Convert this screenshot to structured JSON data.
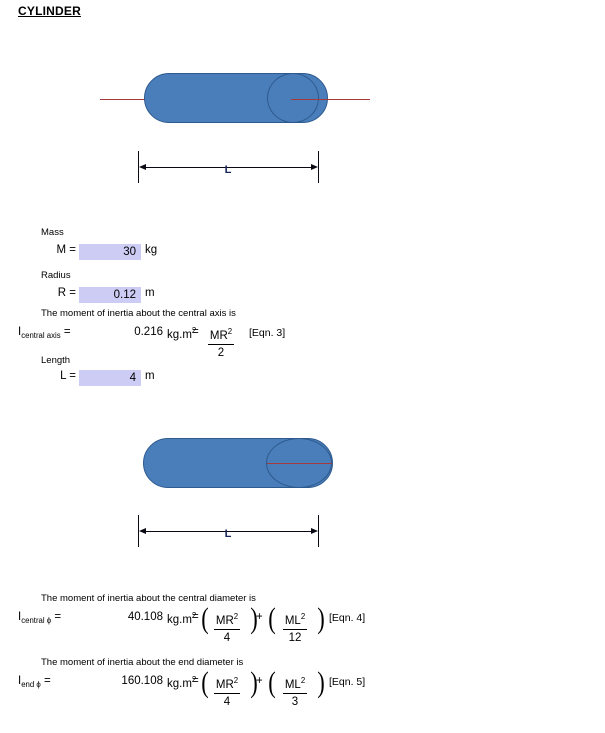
{
  "document": {
    "title": "CYLINDER"
  },
  "diagrams": [
    {
      "name": "cylinder-central-axis",
      "dimension_label": "L",
      "axis_type": "central-axis"
    },
    {
      "name": "cylinder-central-diameter",
      "dimension_label": "L",
      "axis_type": "central-diameter"
    }
  ],
  "inputs": {
    "mass": {
      "caption": "Mass",
      "symbol": "M =",
      "value": "30",
      "unit": "kg"
    },
    "radius": {
      "caption": "Radius",
      "symbol": "R =",
      "value": "0.12",
      "unit": "m"
    },
    "length": {
      "caption": "Length",
      "symbol": "L =",
      "value": "4",
      "unit": "m"
    }
  },
  "results": {
    "central_axis": {
      "sentence": "The moment of inertia about the central axis is",
      "symbol_main": "I",
      "symbol_sub": "central axis",
      "equals": "=",
      "value": "0.216",
      "unit": "kg.m",
      "unit_exp": "2",
      "eq_sign": "=",
      "formula": {
        "terms": [
          {
            "numerator": "MR",
            "numerator_exp": "2",
            "denominator": "2"
          }
        ]
      },
      "reference": "[Eqn. 3]"
    },
    "central_diameter": {
      "sentence": "The moment of inertia about the central diameter is",
      "symbol_main": "I",
      "symbol_sub": "central ϕ",
      "equals": "=",
      "value": "40.108",
      "unit": "kg.m",
      "unit_exp": "2",
      "eq_sign": "=",
      "operator": "+",
      "formula": {
        "terms": [
          {
            "numerator": "MR",
            "numerator_exp": "2",
            "denominator": "4"
          },
          {
            "numerator": "ML",
            "numerator_exp": "2",
            "denominator": "12"
          }
        ]
      },
      "reference": "[Eqn. 4]"
    },
    "end_diameter": {
      "sentence": "The moment of inertia about the end diameter is",
      "symbol_main": "I",
      "symbol_sub": "end ϕ",
      "equals": "=",
      "value": "160.108",
      "unit": "kg.m",
      "unit_exp": "2",
      "eq_sign": "=",
      "operator": "+",
      "formula": {
        "terms": [
          {
            "numerator": "MR",
            "numerator_exp": "2",
            "denominator": "4"
          },
          {
            "numerator": "ML",
            "numerator_exp": "2",
            "denominator": "3"
          }
        ]
      },
      "reference": "[Eqn. 5]"
    }
  },
  "colors": {
    "cylinder_fill": "#4A7EBB",
    "cylinder_stroke": "#2E5A8E",
    "axis_line": "#A33B3B",
    "input_field": "#CCCCF5",
    "dimension_label": "#17255A"
  }
}
